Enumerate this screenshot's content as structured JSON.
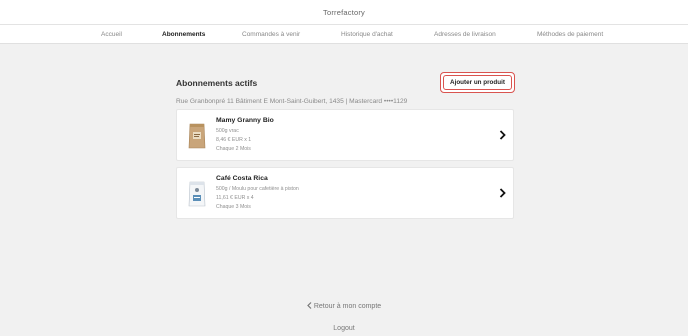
{
  "brand": "Torrefactory",
  "nav": {
    "items": [
      {
        "label": "Accueil"
      },
      {
        "label": "Abonnements"
      },
      {
        "label": "Commandes à venir"
      },
      {
        "label": "Historique d'achat"
      },
      {
        "label": "Adresses de livraison"
      },
      {
        "label": "Méthodes de paiement"
      }
    ],
    "active_index": 1
  },
  "section": {
    "title": "Abonnements actifs",
    "add_button": "Ajouter un produit",
    "address": "Rue Granbonpré 11 Bâtiment E Mont-Saint-Guibert, 1435 | Mastercard ••••1129"
  },
  "subscriptions": [
    {
      "name": "Mamy Granny Bio",
      "detail": "500g vrac",
      "price": "8,46 € EUR x 1",
      "frequency": "Chaque 2 Mois",
      "image": "kraft-coffee-bag-icon"
    },
    {
      "name": "Café Costa Rica",
      "detail": "500g / Moulu pour cafetière à piston",
      "price": "11,61 € EUR x 4",
      "frequency": "Chaque 3 Mois",
      "image": "white-coffee-bag-icon"
    }
  ],
  "footer": {
    "back_label": "Retour à mon compte",
    "logout_label": "Logout"
  },
  "colors": {
    "accent": "#d9534f",
    "background": "#f1f1f1"
  }
}
